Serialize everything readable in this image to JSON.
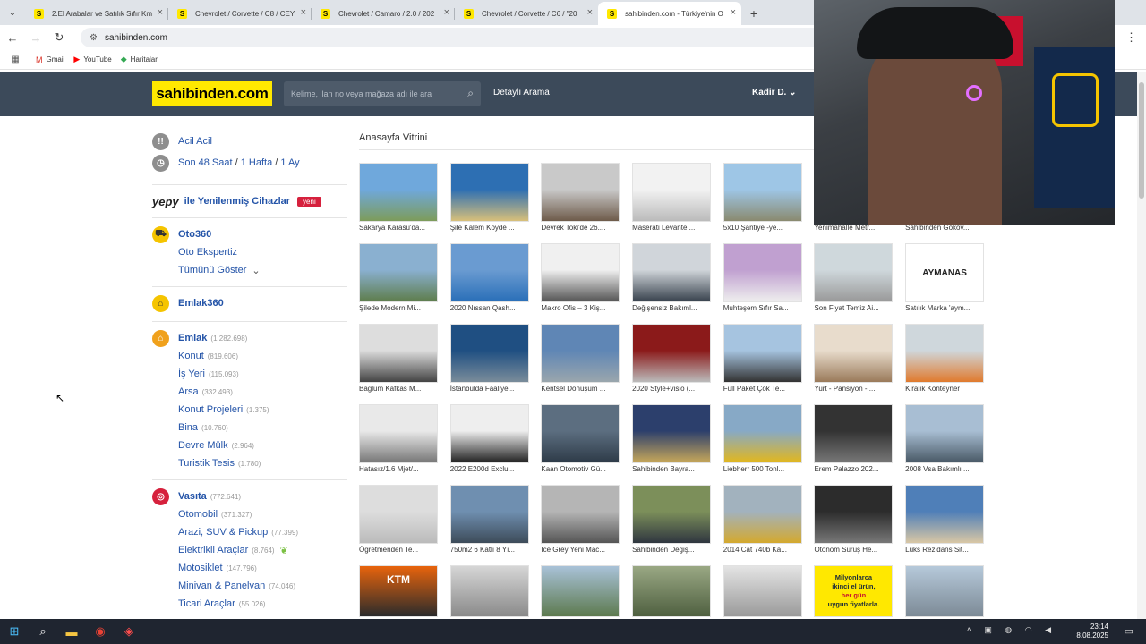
{
  "browser": {
    "tabs": [
      {
        "title": "2.El Arabalar ve Satılık Sıfır Km"
      },
      {
        "title": "Chevrolet / Corvette / C8 / CEY"
      },
      {
        "title": "Chevrolet / Camaro / 2.0 / 202"
      },
      {
        "title": "Chevrolet / Corvette / C6 / \"20"
      },
      {
        "title": "sahibinden.com - Türkiye'nin O"
      }
    ],
    "favicon_letter": "S",
    "url": "sahibinden.com",
    "bookmarks": [
      "Gmail",
      "YouTube",
      "Haritalar"
    ]
  },
  "header": {
    "logo": "sahibinden.com",
    "search_placeholder": "Kelime, ilan no veya mağaza adı ile ara",
    "detailed_search": "Detaylı Arama",
    "user": "Kadir D."
  },
  "sidebar": {
    "acil": "Acil Acil",
    "periods": [
      "Son 48 Saat",
      "1 Hafta",
      "1 Ay"
    ],
    "yepy": "yepy",
    "yepy_text": "ile Yenilenmiş Cihazlar",
    "yeni": "yeni",
    "oto360": "Oto360",
    "oto_ekspertiz": "Oto Ekspertiz",
    "show_all": "Tümünü Göster",
    "emlak360": "Emlak360",
    "emlak": {
      "label": "Emlak",
      "count": "(1.282.698)"
    },
    "emlak_items": [
      {
        "label": "Konut",
        "count": "(819.606)"
      },
      {
        "label": "İş Yeri",
        "count": "(115.093)"
      },
      {
        "label": "Arsa",
        "count": "(332.493)"
      },
      {
        "label": "Konut Projeleri",
        "count": "(1.375)"
      },
      {
        "label": "Bina",
        "count": "(10.760)"
      },
      {
        "label": "Devre Mülk",
        "count": "(2.964)"
      },
      {
        "label": "Turistik Tesis",
        "count": "(1.780)"
      }
    ],
    "vasita": {
      "label": "Vasıta",
      "count": "(772.641)"
    },
    "vasita_items": [
      {
        "label": "Otomobil",
        "count": "(371.327)"
      },
      {
        "label": "Arazi, SUV & Pickup",
        "count": "(77.399)"
      },
      {
        "label": "Elektrikli Araçlar",
        "count": "(8.764)"
      },
      {
        "label": "Motosiklet",
        "count": "(147.796)"
      },
      {
        "label": "Minivan & Panelvan",
        "count": "(74.046)"
      },
      {
        "label": "Ticari Araçlar",
        "count": "(55.026)"
      }
    ]
  },
  "vitrin": {
    "title": "Anasayfa Vitrini",
    "items": [
      "Sakarya Karasu'da...",
      "Şile Kalem Köyde ...",
      "Devrek Toki'de 26....",
      "Maserati Levante ...",
      "5x10 Şantiye -ye...",
      "Yenimahalle Metr...",
      "Sahibinden Gökov...",
      "Şilede Modern Mi...",
      "2020 Nıssan Qash...",
      "Makro Ofis – 3 Kiş...",
      "Değişensiz Bakıml...",
      "Muhteşem Sıfır Sa...",
      "Son Fiyat Temiz Ai...",
      "Satılık Marka 'aym...",
      "Bağlum Kafkas M...",
      "İstanbulda Faaliye...",
      "Kentsel Dönüşüm ...",
      "2020 Style+visio (...",
      "Full Paket Çok Te...",
      "Yurt - Pansiyon - ...",
      "Kiralık Konteyner",
      "Hatasız/1.6 Mjet/...",
      "2022 E200d Exclu...",
      "Kaan Otomotiv Gü...",
      "Sahibinden Bayra...",
      "Liebherr 500 Tonl...",
      "Erem Palazzo 202...",
      "2008 Vsa Bakımlı ...",
      "Öğretmenden Te...",
      "750m2 6 Katlı 8 Yı...",
      "Ice Grey Yeni Mac...",
      "Sahibinden Değiş...",
      "2014 Cat 740b Ka...",
      "Otonom Sürüş He...",
      "Lüks Rezidans Sit..."
    ],
    "aymanas": "AYMANAS",
    "ktm": "KTM",
    "ad_text": [
      "Milyonlarca",
      "ikinci el ürün,",
      "her gün",
      "uygun fiyatlarla."
    ]
  },
  "taskbar": {
    "time": "23:14",
    "date": "8.08.2025"
  }
}
